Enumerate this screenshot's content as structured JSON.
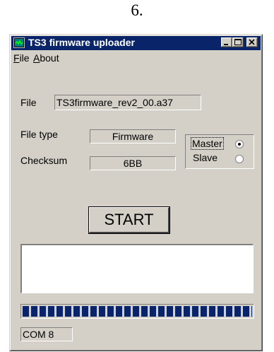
{
  "caption": "6.",
  "window": {
    "title": "TS3 firmware uploader",
    "controls": {
      "minimize": "minimize-icon",
      "maximize": "maximize-icon",
      "close": "close-icon"
    }
  },
  "menu": {
    "file": {
      "accel": "F",
      "rest": "ile"
    },
    "about": {
      "accel": "A",
      "rest": "bout"
    }
  },
  "file_section": {
    "label": "File",
    "value": "TS3firmware_rev2_00.a37"
  },
  "file_type": {
    "label": "File type",
    "value": "Firmware"
  },
  "checksum": {
    "label": "Checksum",
    "value": "6BB"
  },
  "mode": {
    "options": [
      {
        "label": "Master",
        "selected": true
      },
      {
        "label": "Slave",
        "selected": false
      }
    ]
  },
  "start_button": {
    "label": "START"
  },
  "log": {
    "text": ""
  },
  "progress": {
    "percent": 100
  },
  "status": {
    "port": "COM 8"
  },
  "colors": {
    "titlebar": "#0a246a",
    "face": "#d4d0c8",
    "progress": "#0a246a"
  }
}
